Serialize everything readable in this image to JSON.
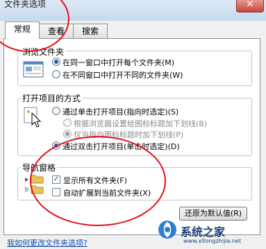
{
  "window": {
    "title": "文件夹选项",
    "close_glyph": "✕"
  },
  "tabs": [
    {
      "label": "常规",
      "active": true
    },
    {
      "label": "查看",
      "active": false
    },
    {
      "label": "搜索",
      "active": false
    }
  ],
  "browse_folders": {
    "legend": "浏览文件夹",
    "options": [
      {
        "label": "在同一窗口中打开每个文件夹(M)",
        "checked": true
      },
      {
        "label": "在不同窗口中打开不同的文件夹(W)",
        "checked": false
      }
    ]
  },
  "click_items": {
    "legend": "打开项目的方式",
    "options": [
      {
        "label": "通过单击打开项目(指向时选定)(S)",
        "checked": false
      },
      {
        "label": "根据浏览器设置给图标标题加下划线(B)",
        "checked": false,
        "disabled": true
      },
      {
        "label": "仅当指向图标标题时加下划线(P)",
        "checked": true,
        "disabled": true
      },
      {
        "label": "通过双击打开项目(单击时选定)(D)",
        "checked": true
      }
    ]
  },
  "nav_pane": {
    "legend": "导航窗格",
    "options": [
      {
        "label": "显示所有文件夹(F)",
        "checked": true
      },
      {
        "label": "自动扩展到当前文件夹(X)",
        "checked": false
      }
    ]
  },
  "buttons": {
    "restore_defaults": "还原为默认值(R)"
  },
  "footer": {
    "help_link": "我如何更改文件夹选项?"
  },
  "watermark": {
    "text": "系统之家",
    "url": "www.xitongzhijia.net"
  },
  "colors": {
    "annotation": "#e4101a",
    "link": "#0f4fb5",
    "radio_dot": "#1d5fa8"
  }
}
